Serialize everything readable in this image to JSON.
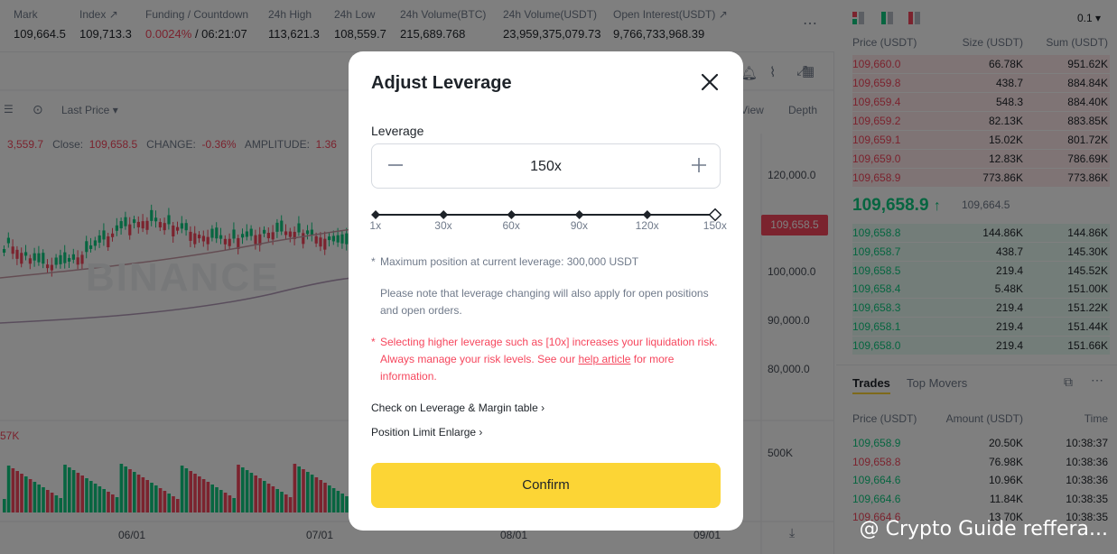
{
  "ticker": {
    "items": [
      {
        "label": "Mark",
        "value": "109,664.5"
      },
      {
        "label": "Index ↗",
        "value": "109,713.3"
      },
      {
        "label": "Funding / Countdown",
        "value_red": "0.0024%",
        "value_rest": " / 06:21:07"
      },
      {
        "label": "24h High",
        "value": "113,621.3"
      },
      {
        "label": "24h Low",
        "value": "108,559.7"
      },
      {
        "label": "24h Volume(BTC)",
        "value": "215,689.768"
      },
      {
        "label": "24h Volume(USDT)",
        "value": "23,959,375,079.73"
      },
      {
        "label": "Open Interest(USDT) ↗",
        "value": "9,766,733,968.39"
      }
    ],
    "more": "⋯"
  },
  "chart": {
    "toolbar": {
      "price_type": "Last Price",
      "view": "View",
      "depth": "Depth"
    },
    "ohlc": {
      "open_partial": "3,559.7",
      "close_label": "Close:",
      "close": "109,658.5",
      "change_label": "CHANGE:",
      "change": "-0.36%",
      "amplitude_label": "AMPLITUDE:",
      "amplitude": "1.36"
    },
    "price_axis": [
      "120,000.0",
      "100,000.0",
      "90,000.0",
      "80,000.0"
    ],
    "current_price": "109,658.5",
    "volume_axis": "500K",
    "volume_label": "57K",
    "dates": [
      "06/01",
      "07/01",
      "08/01",
      "09/01"
    ],
    "watermark": "BINANCE"
  },
  "orderbook": {
    "precision": "0.1",
    "headers": [
      "Price (USDT)",
      "Size (USDT)",
      "Sum (USDT)"
    ],
    "asks": [
      [
        "109,660.0",
        "66.78K",
        "951.62K"
      ],
      [
        "109,659.8",
        "438.7",
        "884.84K"
      ],
      [
        "109,659.4",
        "548.3",
        "884.40K"
      ],
      [
        "109,659.2",
        "82.13K",
        "883.85K"
      ],
      [
        "109,659.1",
        "15.02K",
        "801.72K"
      ],
      [
        "109,659.0",
        "12.83K",
        "786.69K"
      ],
      [
        "109,658.9",
        "773.86K",
        "773.86K"
      ]
    ],
    "last_price": "109,658.9",
    "mark_price": "109,664.5",
    "bids": [
      [
        "109,658.8",
        "144.86K",
        "144.86K"
      ],
      [
        "109,658.7",
        "438.7",
        "145.30K"
      ],
      [
        "109,658.5",
        "219.4",
        "145.52K"
      ],
      [
        "109,658.4",
        "5.48K",
        "151.00K"
      ],
      [
        "109,658.3",
        "219.4",
        "151.22K"
      ],
      [
        "109,658.1",
        "219.4",
        "151.44K"
      ],
      [
        "109,658.0",
        "219.4",
        "151.66K"
      ]
    ]
  },
  "trades": {
    "tabs": [
      "Trades",
      "Top Movers"
    ],
    "headers": [
      "Price (USDT)",
      "Amount (USDT)",
      "Time"
    ],
    "rows": [
      {
        "price": "109,658.9",
        "amount": "20.50K",
        "time": "10:38:37",
        "side": "buy"
      },
      {
        "price": "109,658.8",
        "amount": "76.98K",
        "time": "10:38:36",
        "side": "sell"
      },
      {
        "price": "109,664.6",
        "amount": "10.96K",
        "time": "10:38:36",
        "side": "buy"
      },
      {
        "price": "109,664.6",
        "amount": "11.84K",
        "time": "10:38:35",
        "side": "buy"
      },
      {
        "price": "109,664.6",
        "amount": "13.70K",
        "time": "10:38:35",
        "side": "sell"
      }
    ]
  },
  "modal": {
    "title": "Adjust Leverage",
    "leverage_label": "Leverage",
    "leverage_value": "150x",
    "slider_ticks": [
      "1x",
      "30x",
      "60x",
      "90x",
      "120x",
      "150x"
    ],
    "slider_fraction": 1.0,
    "note_max_star": "*",
    "note_max": "Maximum position at current leverage: 300,000 USDT",
    "note_change": "Please note that leverage changing will also apply for open positions and open orders.",
    "warn_star": "*",
    "warn_text_1": "Selecting higher leverage such as [10x] increases your liquidation risk. Always manage your risk levels. See our ",
    "warn_link": "help article",
    "warn_text_2": " for more information.",
    "link_margin_table": "Check on Leverage & Margin table",
    "link_position_limit": "Position Limit Enlarge",
    "confirm": "Confirm"
  },
  "watermark_text": "@ Crypto Guide reffera...",
  "colors": {
    "accent": "#fcd535",
    "up": "#0ecb81",
    "down": "#f6465d"
  }
}
